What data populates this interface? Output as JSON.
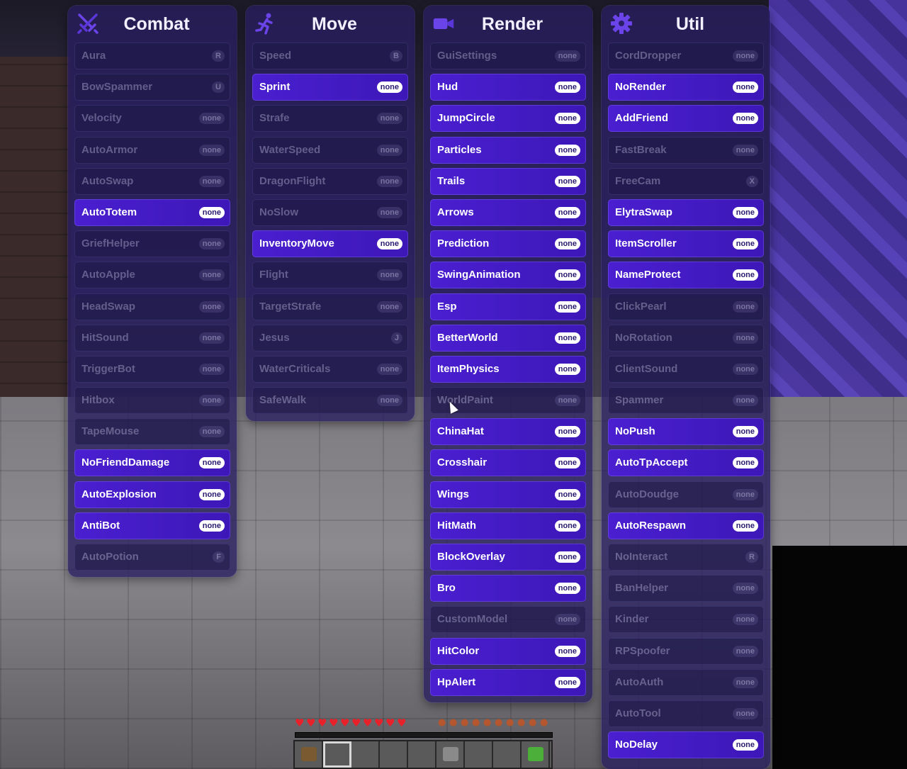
{
  "panels": [
    {
      "title": "Combat",
      "icon": "crossed-swords-icon",
      "items": [
        {
          "name": "Aura",
          "key": "R",
          "enabled": false
        },
        {
          "name": "BowSpammer",
          "key": "U",
          "enabled": false
        },
        {
          "name": "Velocity",
          "key": "none",
          "enabled": false
        },
        {
          "name": "AutoArmor",
          "key": "none",
          "enabled": false
        },
        {
          "name": "AutoSwap",
          "key": "none",
          "enabled": false
        },
        {
          "name": "AutoTotem",
          "key": "none",
          "enabled": true
        },
        {
          "name": "GriefHelper",
          "key": "none",
          "enabled": false
        },
        {
          "name": "AutoApple",
          "key": "none",
          "enabled": false
        },
        {
          "name": "HeadSwap",
          "key": "none",
          "enabled": false
        },
        {
          "name": "HitSound",
          "key": "none",
          "enabled": false
        },
        {
          "name": "TriggerBot",
          "key": "none",
          "enabled": false
        },
        {
          "name": "Hitbox",
          "key": "none",
          "enabled": false
        },
        {
          "name": "TapeMouse",
          "key": "none",
          "enabled": false
        },
        {
          "name": "NoFriendDamage",
          "key": "none",
          "enabled": true
        },
        {
          "name": "AutoExplosion",
          "key": "none",
          "enabled": true
        },
        {
          "name": "AntiBot",
          "key": "none",
          "enabled": true
        },
        {
          "name": "AutoPotion",
          "key": "F",
          "enabled": false
        }
      ]
    },
    {
      "title": "Move",
      "icon": "running-person-icon",
      "items": [
        {
          "name": "Speed",
          "key": "B",
          "enabled": false
        },
        {
          "name": "Sprint",
          "key": "none",
          "enabled": true
        },
        {
          "name": "Strafe",
          "key": "none",
          "enabled": false
        },
        {
          "name": "WaterSpeed",
          "key": "none",
          "enabled": false
        },
        {
          "name": "DragonFlight",
          "key": "none",
          "enabled": false
        },
        {
          "name": "NoSlow",
          "key": "none",
          "enabled": false
        },
        {
          "name": "InventoryMove",
          "key": "none",
          "enabled": true
        },
        {
          "name": "Flight",
          "key": "none",
          "enabled": false
        },
        {
          "name": "TargetStrafe",
          "key": "none",
          "enabled": false
        },
        {
          "name": "Jesus",
          "key": "J",
          "enabled": false
        },
        {
          "name": "WaterCriticals",
          "key": "none",
          "enabled": false
        },
        {
          "name": "SafeWalk",
          "key": "none",
          "enabled": false
        }
      ]
    },
    {
      "title": "Render",
      "icon": "video-camera-icon",
      "items": [
        {
          "name": "GuiSettings",
          "key": "none",
          "enabled": false
        },
        {
          "name": "Hud",
          "key": "none",
          "enabled": true
        },
        {
          "name": "JumpCircle",
          "key": "none",
          "enabled": true
        },
        {
          "name": "Particles",
          "key": "none",
          "enabled": true
        },
        {
          "name": "Trails",
          "key": "none",
          "enabled": true
        },
        {
          "name": "Arrows",
          "key": "none",
          "enabled": true
        },
        {
          "name": "Prediction",
          "key": "none",
          "enabled": true
        },
        {
          "name": "SwingAnimation",
          "key": "none",
          "enabled": true
        },
        {
          "name": "Esp",
          "key": "none",
          "enabled": true
        },
        {
          "name": "BetterWorld",
          "key": "none",
          "enabled": true
        },
        {
          "name": "ItemPhysics",
          "key": "none",
          "enabled": true
        },
        {
          "name": "WorldPaint",
          "key": "none",
          "enabled": false
        },
        {
          "name": "ChinaHat",
          "key": "none",
          "enabled": true
        },
        {
          "name": "Crosshair",
          "key": "none",
          "enabled": true
        },
        {
          "name": "Wings",
          "key": "none",
          "enabled": true
        },
        {
          "name": "HitMath",
          "key": "none",
          "enabled": true
        },
        {
          "name": "BlockOverlay",
          "key": "none",
          "enabled": true
        },
        {
          "name": "Bro",
          "key": "none",
          "enabled": true
        },
        {
          "name": "CustomModel",
          "key": "none",
          "enabled": false
        },
        {
          "name": "HitColor",
          "key": "none",
          "enabled": true
        },
        {
          "name": "HpAlert",
          "key": "none",
          "enabled": true
        }
      ]
    },
    {
      "title": "Util",
      "icon": "gear-icon",
      "items": [
        {
          "name": "CordDropper",
          "key": "none",
          "enabled": false
        },
        {
          "name": "NoRender",
          "key": "none",
          "enabled": true
        },
        {
          "name": "AddFriend",
          "key": "none",
          "enabled": true
        },
        {
          "name": "FastBreak",
          "key": "none",
          "enabled": false
        },
        {
          "name": "FreeCam",
          "key": "X",
          "enabled": false
        },
        {
          "name": "ElytraSwap",
          "key": "none",
          "enabled": true
        },
        {
          "name": "ItemScroller",
          "key": "none",
          "enabled": true
        },
        {
          "name": "NameProtect",
          "key": "none",
          "enabled": true
        },
        {
          "name": "ClickPearl",
          "key": "none",
          "enabled": false
        },
        {
          "name": "NoRotation",
          "key": "none",
          "enabled": false
        },
        {
          "name": "ClientSound",
          "key": "none",
          "enabled": false
        },
        {
          "name": "Spammer",
          "key": "none",
          "enabled": false
        },
        {
          "name": "NoPush",
          "key": "none",
          "enabled": true
        },
        {
          "name": "AutoTpAccept",
          "key": "none",
          "enabled": true
        },
        {
          "name": "AutoDoudge",
          "key": "none",
          "enabled": false
        },
        {
          "name": "AutoRespawn",
          "key": "none",
          "enabled": true
        },
        {
          "name": "NoInteract",
          "key": "R",
          "enabled": false
        },
        {
          "name": "BanHelper",
          "key": "none",
          "enabled": false
        },
        {
          "name": "Kinder",
          "key": "none",
          "enabled": false
        },
        {
          "name": "RPSpoofer",
          "key": "none",
          "enabled": false
        },
        {
          "name": "AutoAuth",
          "key": "none",
          "enabled": false
        },
        {
          "name": "AutoTool",
          "key": "none",
          "enabled": false
        },
        {
          "name": "NoDelay",
          "key": "none",
          "enabled": true
        }
      ]
    }
  ],
  "hud": {
    "hearts": 10,
    "hunger": 10,
    "hotbar_slots": 9,
    "selected_slot": 2
  },
  "colors": {
    "panel_bg": "#281e5f",
    "enabled_item": "#4a1fd0",
    "badge_enabled": "#ffffff",
    "heart": "#e8202a"
  }
}
